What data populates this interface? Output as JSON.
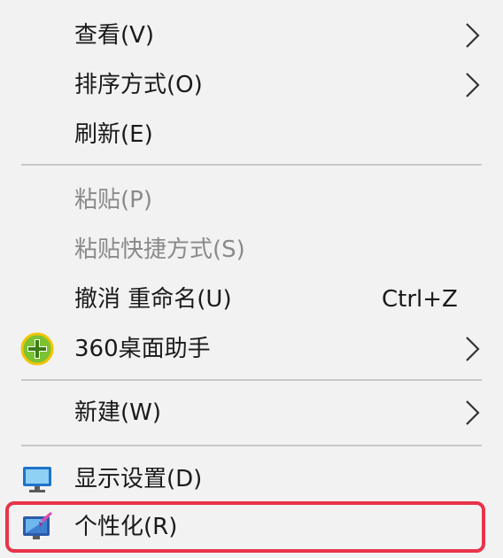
{
  "context_menu": {
    "items": [
      {
        "label": "查看(V)"
      },
      {
        "label": "排序方式(O)"
      },
      {
        "label": "刷新(E)"
      },
      {
        "label": "粘贴(P)"
      },
      {
        "label": "粘贴快捷方式(S)"
      },
      {
        "label": "撤消 重命名(U)",
        "shortcut": "Ctrl+Z"
      },
      {
        "label": "360桌面助手",
        "icon": "plus-circle-icon"
      },
      {
        "label": "新建(W)"
      },
      {
        "label": "显示设置(D)",
        "icon": "monitor-icon"
      },
      {
        "label": "个性化(R)",
        "icon": "personalize-icon"
      }
    ],
    "disabled_color": "#8a8a8a",
    "highlight_color": "#e8344a"
  }
}
